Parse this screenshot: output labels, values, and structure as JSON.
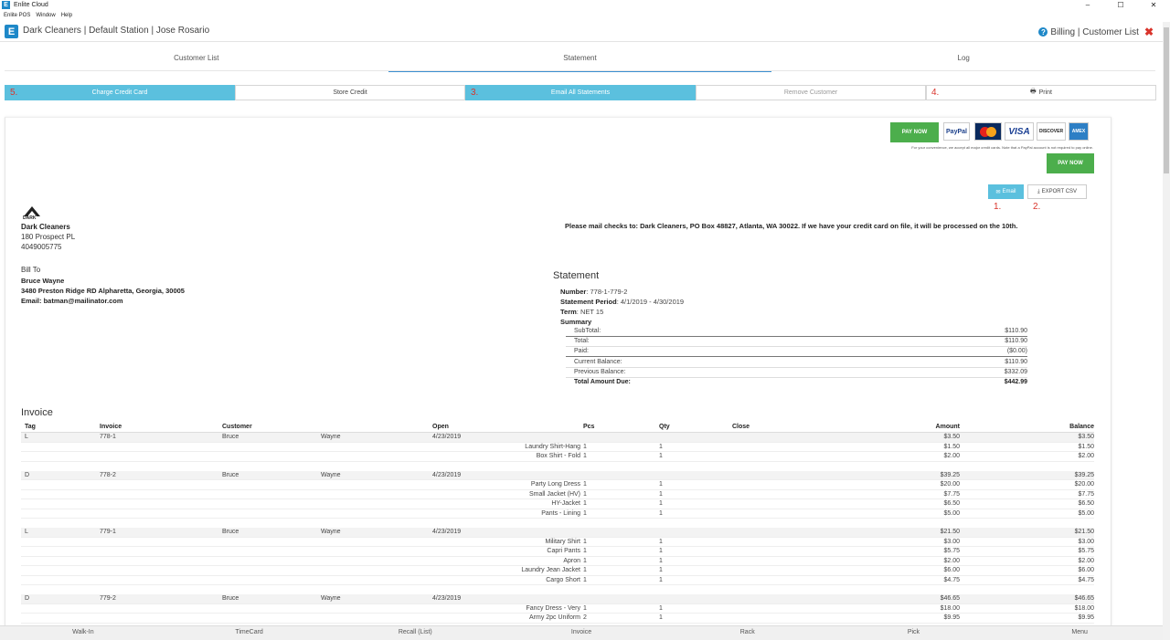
{
  "window": {
    "title": "Enlite Cloud",
    "controls": [
      "–",
      "☐",
      "✕"
    ]
  },
  "menu": [
    "Enlite POS",
    "Window",
    "Help"
  ],
  "header": {
    "context": "Dark Cleaners | Default Station | Jose Rosario",
    "right_text": "Billing | Customer List"
  },
  "tabs": [
    "Customer List",
    "Statement",
    "Log"
  ],
  "actions": {
    "charge": "Charge Credit Card",
    "store_credit": "Store Credit",
    "email_all": "Email All Statements",
    "remove": "Remove Customer",
    "print": "Print"
  },
  "annotations": {
    "a1": "1.",
    "a2": "2.",
    "a3": "3.",
    "a4": "4.",
    "a5": "5."
  },
  "payment": {
    "paynow": "PAY NOW",
    "paypal": "PayPal",
    "visa": "VISA",
    "discover": "DISCOVER",
    "amex": "AMEX",
    "note": "For your convenience, we accept all major credit cards. Note that a PayPal account is not required to pay online."
  },
  "buttons": {
    "email": "Email",
    "export": "EXPORT CSV"
  },
  "company": {
    "logo_text": "DARK",
    "name": "Dark Cleaners",
    "address": "180 Prospect PL",
    "phone": "4049005775",
    "mail_note": "Please mail checks to: Dark Cleaners, PO Box 48827, Atlanta, WA 30022. If we have your credit card on file, it will be processed on the 10th."
  },
  "bill_to": {
    "heading": "Bill To",
    "name": "Bruce Wayne",
    "address": "3480 Preston Ridge RD Alpharetta, Georgia, 30005",
    "email": "Email: batman@mailinator.com"
  },
  "statement": {
    "heading": "Statement",
    "number_label": "Number",
    "number": ": 778-1-779-2",
    "period_label": "Statement Period",
    "period": ": 4/1/2019 - 4/30/2019",
    "term_label": "Term",
    "term": ": NET 15",
    "summary_label": "Summary",
    "summary": [
      {
        "label": "SubTotal:",
        "value": "$110.90"
      },
      {
        "label": "Total:",
        "value": "$110.90"
      },
      {
        "label": "Paid:",
        "value": "($0.00)"
      },
      {
        "label": "Current Balance:",
        "value": "$110.90"
      },
      {
        "label": "Previous Balance:",
        "value": "$332.09"
      },
      {
        "label": "Total Amount Due:",
        "value": "$442.99"
      }
    ]
  },
  "invoice": {
    "heading": "Invoice",
    "columns": [
      "Tag",
      "Invoice",
      "Customer",
      "Open",
      "Pcs",
      "Qty",
      "Close",
      "Amount",
      "Balance"
    ],
    "groups": [
      {
        "tag": "L",
        "invoice": "778-1",
        "first": "Bruce",
        "last": "Wayne",
        "open": "4/23/2019",
        "amount": "$3.50",
        "balance": "$3.50",
        "items": [
          {
            "name": "Laundry Shirt-Hang",
            "pcs": "1",
            "qty": "1",
            "amount": "$1.50",
            "balance": "$1.50"
          },
          {
            "name": "Box Shirt - Fold",
            "pcs": "1",
            "qty": "1",
            "amount": "$2.00",
            "balance": "$2.00"
          }
        ]
      },
      {
        "tag": "D",
        "invoice": "778-2",
        "first": "Bruce",
        "last": "Wayne",
        "open": "4/23/2019",
        "amount": "$39.25",
        "balance": "$39.25",
        "items": [
          {
            "name": "Party Long Dress",
            "pcs": "1",
            "qty": "1",
            "amount": "$20.00",
            "balance": "$20.00"
          },
          {
            "name": "Small Jacket (HV)",
            "pcs": "1",
            "qty": "1",
            "amount": "$7.75",
            "balance": "$7.75"
          },
          {
            "name": "HY-Jacket",
            "pcs": "1",
            "qty": "1",
            "amount": "$6.50",
            "balance": "$6.50"
          },
          {
            "name": "Pants - Lining",
            "pcs": "1",
            "qty": "1",
            "amount": "$5.00",
            "balance": "$5.00"
          }
        ]
      },
      {
        "tag": "L",
        "invoice": "779-1",
        "first": "Bruce",
        "last": "Wayne",
        "open": "4/23/2019",
        "amount": "$21.50",
        "balance": "$21.50",
        "items": [
          {
            "name": "Military Shirt",
            "pcs": "1",
            "qty": "1",
            "amount": "$3.00",
            "balance": "$3.00"
          },
          {
            "name": "Capri Pants",
            "pcs": "1",
            "qty": "1",
            "amount": "$5.75",
            "balance": "$5.75"
          },
          {
            "name": "Apron",
            "pcs": "1",
            "qty": "1",
            "amount": "$2.00",
            "balance": "$2.00"
          },
          {
            "name": "Laundry Jean Jacket",
            "pcs": "1",
            "qty": "1",
            "amount": "$6.00",
            "balance": "$6.00"
          },
          {
            "name": "Cargo Short",
            "pcs": "1",
            "qty": "1",
            "amount": "$4.75",
            "balance": "$4.75"
          }
        ]
      },
      {
        "tag": "D",
        "invoice": "779-2",
        "first": "Bruce",
        "last": "Wayne",
        "open": "4/23/2019",
        "amount": "$46.65",
        "balance": "$46.65",
        "items": [
          {
            "name": "Fancy Dress - Very",
            "pcs": "1",
            "qty": "1",
            "amount": "$18.00",
            "balance": "$18.00"
          },
          {
            "name": "Army 2pc Uniform",
            "pcs": "2",
            "qty": "1",
            "amount": "$9.95",
            "balance": "$9.95"
          }
        ]
      }
    ]
  },
  "bottom_nav": [
    "Walk-In",
    "TimeCard",
    "Recall (List)",
    "Invoice",
    "Rack",
    "Pick",
    "Menu"
  ]
}
